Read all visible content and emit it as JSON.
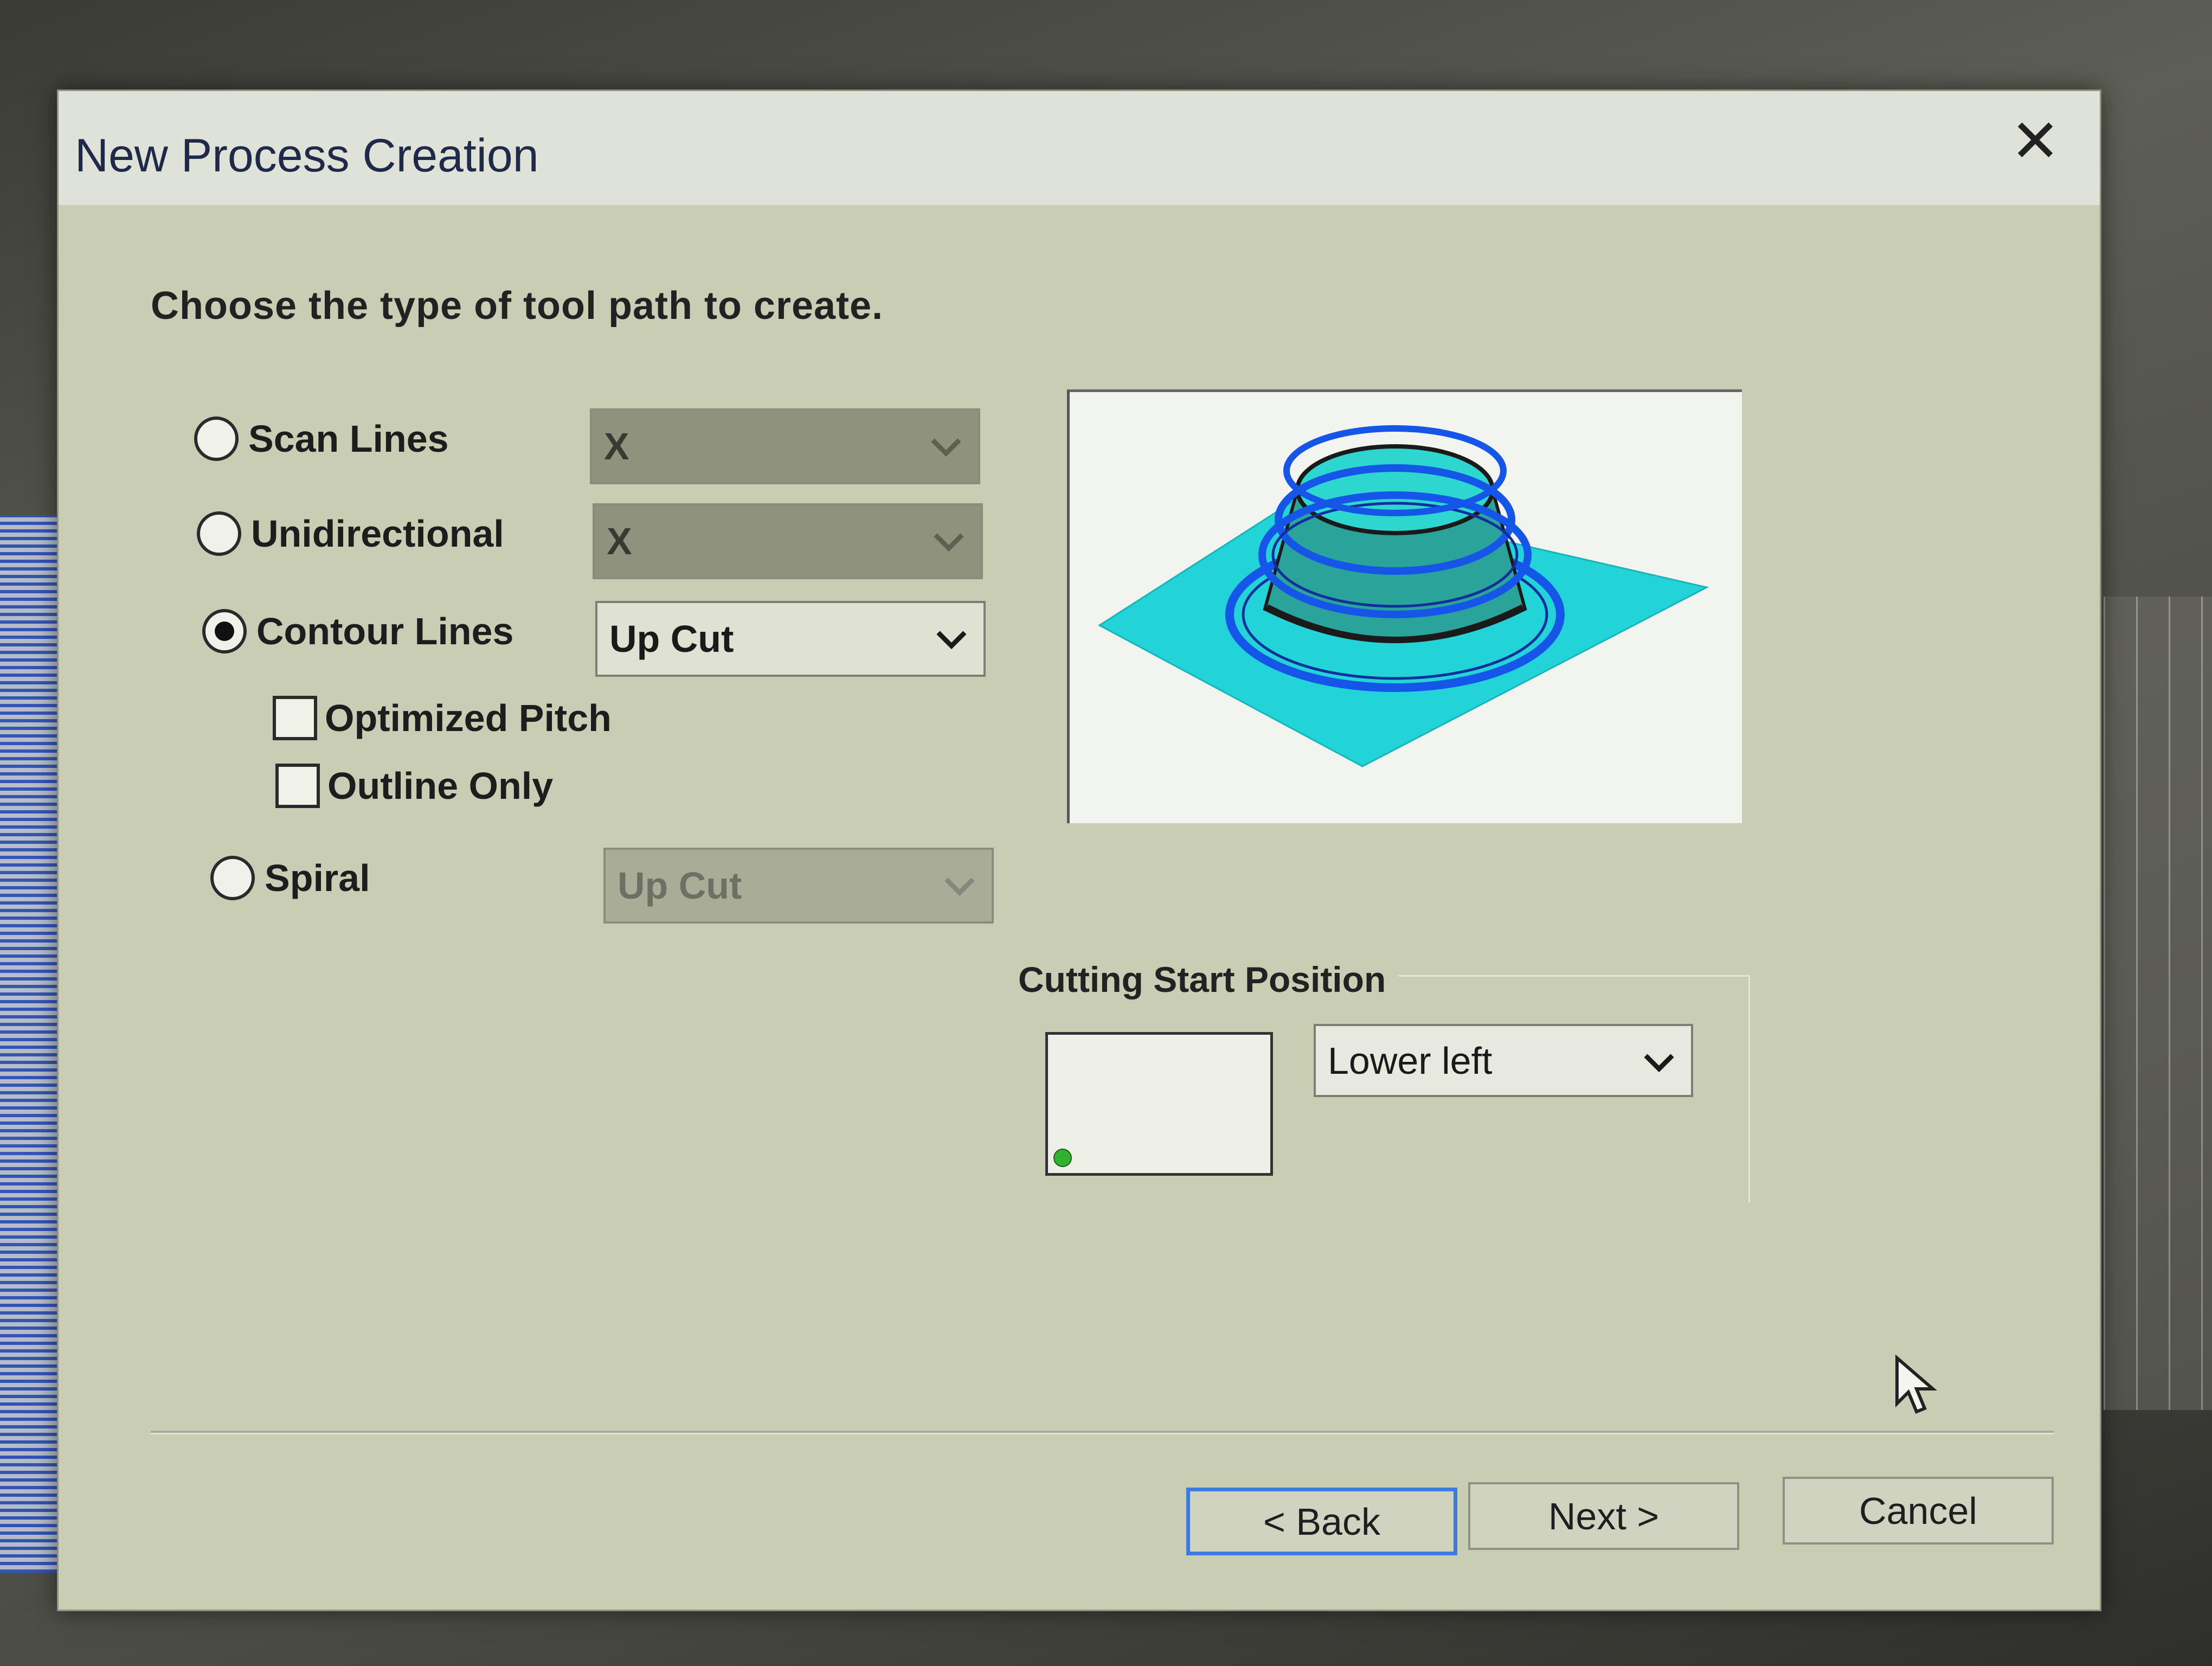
{
  "dialog": {
    "title": "New Process Creation",
    "close_symbol": "✕",
    "prompt": "Choose the type of tool path to create."
  },
  "options": {
    "scan_lines": {
      "label": "Scan Lines",
      "selected": false,
      "combo_value": "X",
      "combo_enabled": false
    },
    "unidirectional": {
      "label": "Unidirectional",
      "selected": false,
      "combo_value": "X",
      "combo_enabled": false
    },
    "contour_lines": {
      "label": "Contour Lines",
      "selected": true,
      "combo_value": "Up Cut",
      "combo_enabled": true
    },
    "optimized_pitch": {
      "label": "Optimized Pitch",
      "checked": false
    },
    "outline_only": {
      "label": "Outline Only",
      "checked": false
    },
    "spiral": {
      "label": "Spiral",
      "selected": false,
      "combo_value": "Up Cut",
      "combo_enabled": false
    }
  },
  "preview": {
    "icon": "contour-toolpath-preview"
  },
  "cutting_start": {
    "label": "Cutting Start Position",
    "value": "Lower left",
    "marker_color": "#2fb32f"
  },
  "buttons": {
    "back": "< Back",
    "next": "Next >",
    "cancel": "Cancel"
  },
  "colors": {
    "dialog_bg": "#c9cdb4",
    "default_button_border": "#3d7bdc",
    "preview_plane": "#22d3d8",
    "preview_rings": "#1556e8"
  }
}
